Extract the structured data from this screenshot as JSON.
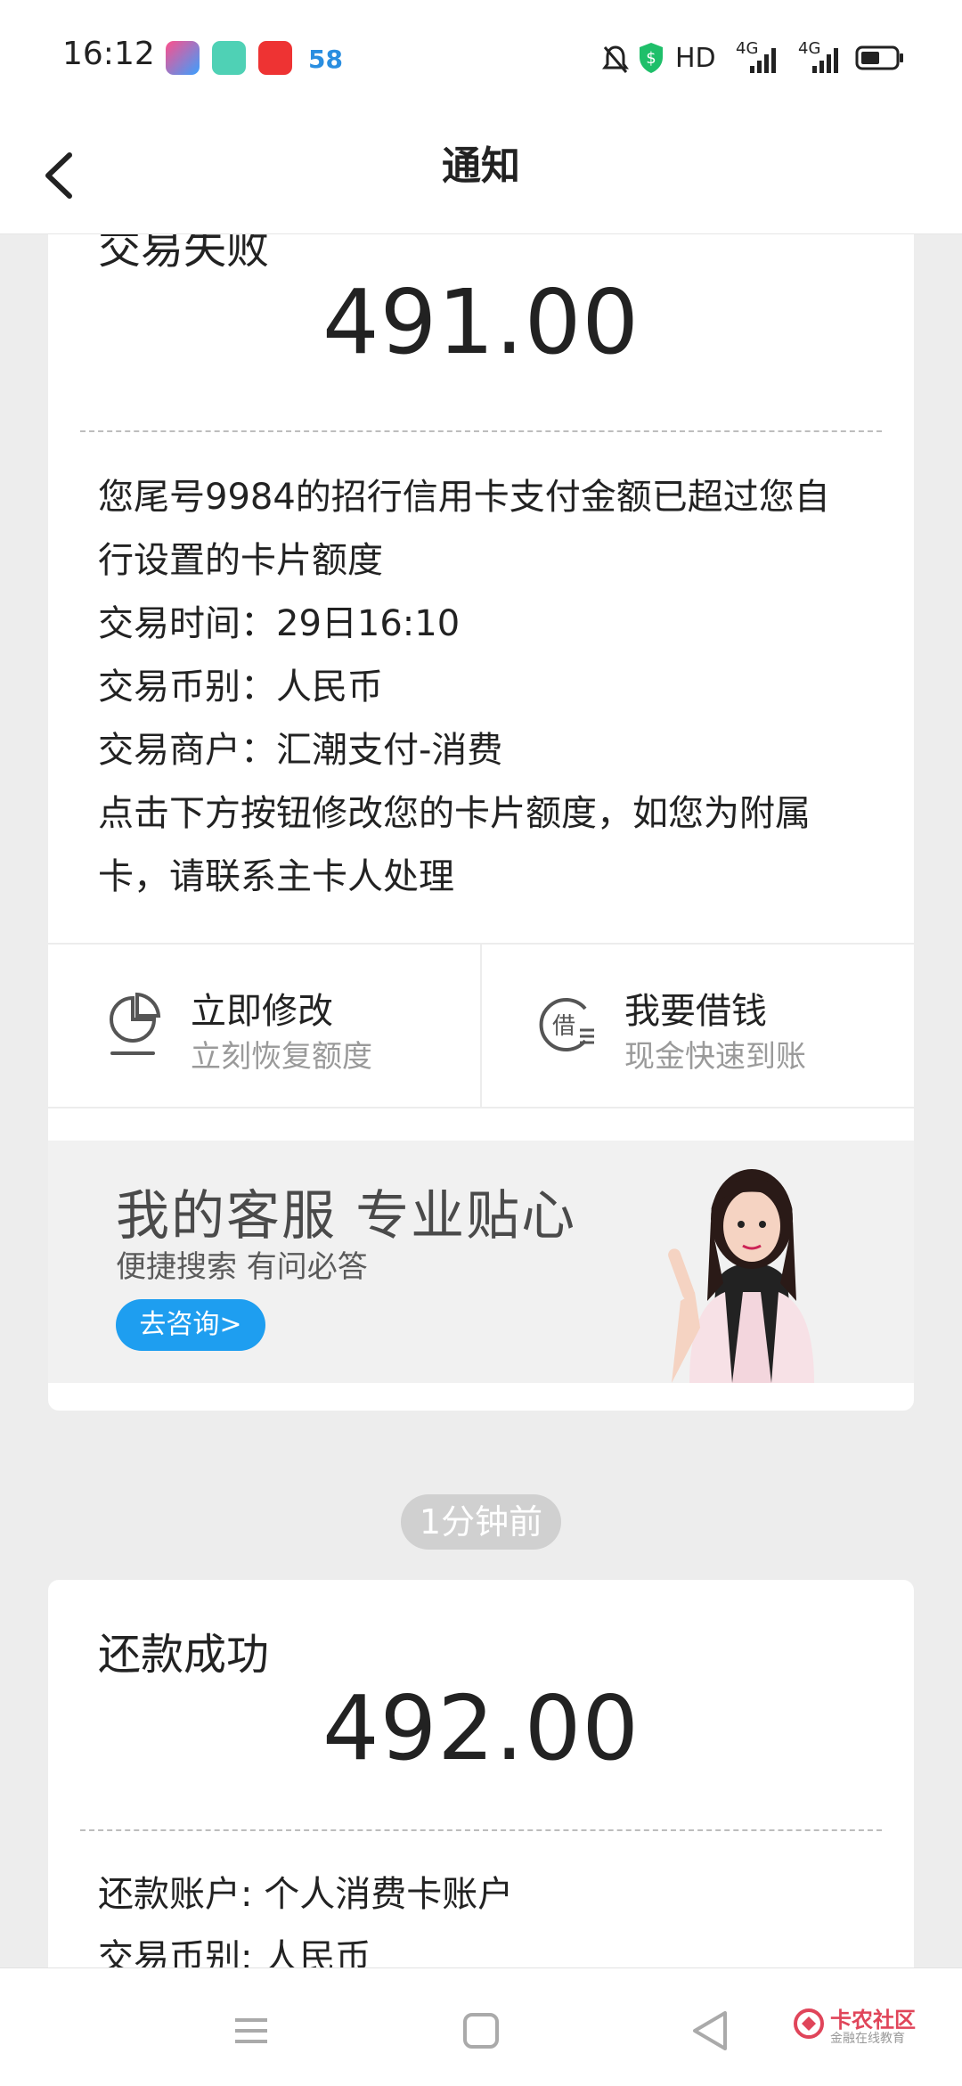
{
  "status_bar": {
    "time": "16:12",
    "network": "HD",
    "signal1": "4G",
    "signal2": "4G",
    "icons": [
      "video-app-icon",
      "square-app-icon",
      "flower-app-icon",
      "58-app-icon",
      "mute-icon",
      "shield-icon",
      "battery-icon"
    ],
    "app4_label": "58"
  },
  "nav": {
    "title": "通知"
  },
  "card1": {
    "title": "交易失败",
    "amount": "491.00",
    "lines": [
      "您尾号9984的招行信用卡支付金额已超过您自",
      "行设置的卡片额度",
      "交易时间：29日16:10",
      "交易币别：人民币",
      "交易商户：汇潮支付-消费",
      "点击下方按钮修改您的卡片额度，如您为附属",
      "卡，请联系主卡人处理"
    ],
    "action_left": {
      "label": "立即修改",
      "sub": "立刻恢复额度"
    },
    "action_right": {
      "label": "我要借钱",
      "sub": "现金快速到账",
      "icon_char": "借"
    },
    "banner": {
      "title": "我的客服 专业贴心",
      "subtitle": "便捷搜索 有问必答",
      "button": "去咨询>"
    }
  },
  "time_pill": "1分钟前",
  "card2": {
    "title": "还款成功",
    "amount": "492.00",
    "lines": [
      "还款账户: 个人消费卡账户",
      "交易币别: 人民币"
    ]
  },
  "watermark": {
    "text": "卡农社区",
    "sub": "金融在线教育"
  },
  "colors": {
    "accent": "#1e9ef0",
    "background": "#ededed",
    "watermark": "#e0455a"
  }
}
